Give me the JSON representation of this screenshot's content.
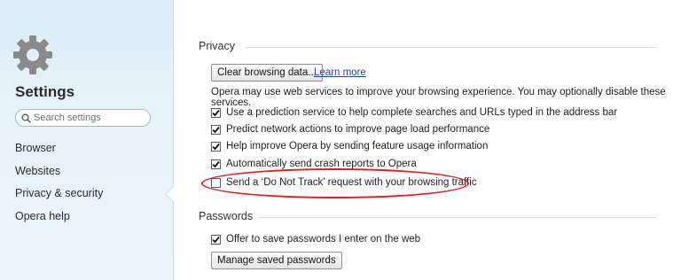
{
  "sidebar": {
    "title": "Settings",
    "search_placeholder": "Search settings",
    "icons": {
      "logo": "gear-icon",
      "search": "search-icon"
    },
    "items": [
      {
        "label": "Browser"
      },
      {
        "label": "Websites"
      },
      {
        "label": "Privacy & security",
        "selected": true
      },
      {
        "label": "Opera help"
      }
    ]
  },
  "privacy": {
    "heading": "Privacy",
    "clear_button": "Clear browsing data...",
    "learn_more": "Learn more",
    "description": "Opera may use web services to improve your browsing experience. You may optionally disable these services.",
    "options": [
      {
        "label": "Use a prediction service to help complete searches and URLs typed in the address bar",
        "checked": true
      },
      {
        "label": "Predict network actions to improve page load performance",
        "checked": true
      },
      {
        "label": "Help improve Opera by sending feature usage information",
        "checked": true
      },
      {
        "label": "Automatically send crash reports to Opera",
        "checked": true
      },
      {
        "label": "Send a ‘Do Not Track’ request with your browsing traffic",
        "checked": false,
        "highlighted": true
      }
    ]
  },
  "passwords": {
    "heading": "Passwords",
    "offer_label": "Offer to save passwords I enter on the web",
    "offer_checked": true,
    "manage_button": "Manage saved passwords"
  },
  "colors": {
    "sidebar_bg": "#e2eff8",
    "link": "#1a44b8",
    "highlight_ellipse": "#e21b1b"
  }
}
